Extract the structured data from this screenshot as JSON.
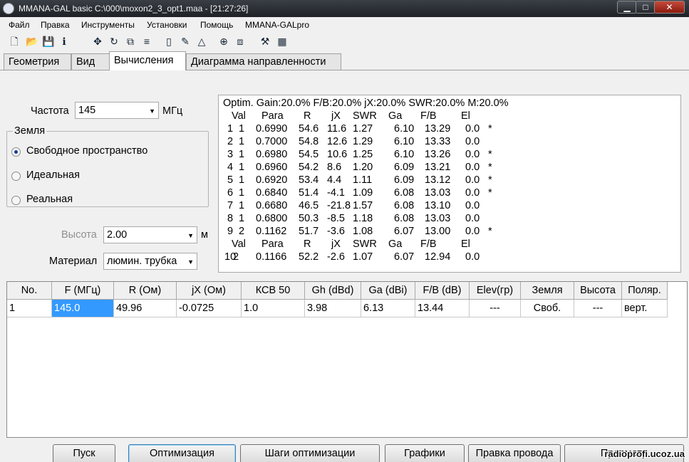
{
  "window": {
    "title": "MMANA-GAL basic C:\\000\\moxon2_3_opt1.maa - [21:27:26]",
    "minimize": "▁",
    "maximize": "□",
    "close": "✕"
  },
  "menu": [
    "Файл",
    "Правка",
    "Инструменты",
    "Установки",
    "Помощь",
    "MMANA-GALpro"
  ],
  "toolbar_icons": [
    "new-file-icon",
    "open-folder-icon",
    "save-icon",
    "info-icon",
    "move-icon",
    "rotate-icon",
    "copy-icon",
    "wire-edit-icon",
    "page-icon",
    "pen-icon",
    "triangle-icon",
    "crosshair-icon",
    "duplicate-icon",
    "tools-icon",
    "calculator-icon"
  ],
  "tabs": [
    "Геометрия",
    "Вид",
    "Вычисления",
    "Диаграмма направленности"
  ],
  "params": {
    "freq_label": "Частота",
    "freq_value": "145",
    "freq_unit": "МГц",
    "ground_title": "Земля",
    "ground_options": [
      "Свободное пространство",
      "Идеальная",
      "Реальная"
    ],
    "ground_selected": 0,
    "height_label": "Высота",
    "height_value": "2.00",
    "height_unit": "м",
    "material_label": "Материал",
    "material_value": "люмин. трубка"
  },
  "optim": {
    "header": "Optim. Gain:20.0% F/B:20.0% jX:20.0% SWR:20.0% M:20.0%",
    "columns": [
      "Val",
      "Para",
      "R",
      "jX",
      "SWR",
      "Ga",
      "F/B",
      "El"
    ],
    "rows": [
      {
        "n": "1",
        "v": "1",
        "para": "0.6990",
        "r": "54.6",
        "jx": "11.6",
        "swr": "1.27",
        "ga": "6.10",
        "fb": "13.29",
        "el": "0.0",
        "mark": "*"
      },
      {
        "n": "2",
        "v": "1",
        "para": "0.7000",
        "r": "54.8",
        "jx": "12.6",
        "swr": "1.29",
        "ga": "6.10",
        "fb": "13.33",
        "el": "0.0",
        "mark": ""
      },
      {
        "n": "3",
        "v": "1",
        "para": "0.6980",
        "r": "54.5",
        "jx": "10.6",
        "swr": "1.25",
        "ga": "6.10",
        "fb": "13.26",
        "el": "0.0",
        "mark": "*"
      },
      {
        "n": "4",
        "v": "1",
        "para": "0.6960",
        "r": "54.2",
        "jx": "8.6",
        "swr": "1.20",
        "ga": "6.09",
        "fb": "13.21",
        "el": "0.0",
        "mark": "*"
      },
      {
        "n": "5",
        "v": "1",
        "para": "0.6920",
        "r": "53.4",
        "jx": "4.4",
        "swr": "1.11",
        "ga": "6.09",
        "fb": "13.12",
        "el": "0.0",
        "mark": "*"
      },
      {
        "n": "6",
        "v": "1",
        "para": "0.6840",
        "r": "51.4",
        "jx": "-4.1",
        "swr": "1.09",
        "ga": "6.08",
        "fb": "13.03",
        "el": "0.0",
        "mark": "*"
      },
      {
        "n": "7",
        "v": "1",
        "para": "0.6680",
        "r": "46.5",
        "jx": "-21.8",
        "swr": "1.57",
        "ga": "6.08",
        "fb": "13.10",
        "el": "0.0",
        "mark": ""
      },
      {
        "n": "8",
        "v": "1",
        "para": "0.6800",
        "r": "50.3",
        "jx": "-8.5",
        "swr": "1.18",
        "ga": "6.08",
        "fb": "13.03",
        "el": "0.0",
        "mark": ""
      },
      {
        "n": "9",
        "v": "2",
        "para": "0.1162",
        "r": "51.7",
        "jx": "-3.6",
        "swr": "1.08",
        "ga": "6.07",
        "fb": "13.00",
        "el": "0.0",
        "mark": "*"
      }
    ],
    "columns2": [
      "Val",
      "Para",
      "R",
      "jX",
      "SWR",
      "Ga",
      "F/B",
      "El"
    ],
    "last_row": {
      "n": "10",
      "v": "2",
      "para": "0.1166",
      "r": "52.2",
      "jx": "-2.6",
      "swr": "1.07",
      "ga": "6.07",
      "fb": "12.94",
      "el": "0.0",
      "mark": ""
    }
  },
  "table": {
    "headers": [
      "No.",
      "F (МГц)",
      "R (Ом)",
      "jX (Ом)",
      "КСВ 50",
      "Gh (dBd)",
      "Ga (dBi)",
      "F/B (dB)",
      "Elev(гр)",
      "Земля",
      "Высота",
      "Поляр."
    ],
    "row": [
      "1",
      "145.0",
      "49.96",
      "-0.0725",
      "1.0",
      "3.98",
      "6.13",
      "13.44",
      "---",
      "Своб.",
      "---",
      "верт."
    ]
  },
  "buttons": [
    "Пуск",
    "Оптимизация",
    "Шаги оптимизации",
    "Графики",
    "Правка провода",
    "Просмотр"
  ],
  "watermark": "radioprofi.ucoz.ua"
}
